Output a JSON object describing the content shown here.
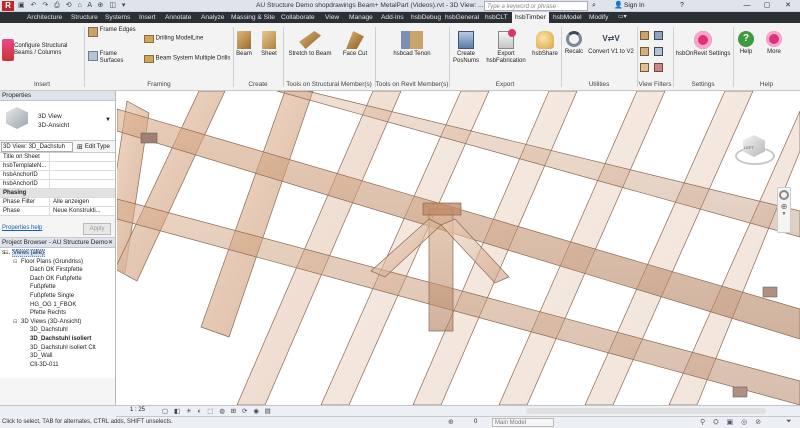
{
  "window": {
    "title": "AU Structure Demo shopdrawings Beam+ MetalPart (Videos).rvt - 3D View: ...",
    "search_placeholder": "Type a keyword or phrase",
    "sign_in": "Sign In"
  },
  "menu": {
    "tabs": [
      "Architecture",
      "Structure",
      "Systems",
      "Insert",
      "Annotate",
      "Analyze",
      "Massing & Site",
      "Collaborate",
      "View",
      "Manage",
      "Add-Ins",
      "hsbDebug",
      "hsbGeneral",
      "hsbCLT",
      "hsbTimber",
      "hsbModel",
      "Modify"
    ],
    "active": "hsbTimber"
  },
  "ribbon": {
    "insert": {
      "configure": "Configure Structural Beams / Columns",
      "group": "Insert"
    },
    "framing": {
      "frame_edges": "Frame Edges",
      "frame_surfaces": "Frame Surfaces",
      "drilling": "Drilling ModelLine",
      "beam_system": "Beam System Multiple Drills",
      "group": "Framing"
    },
    "create": {
      "beam": "Beam",
      "sheet": "Sheet",
      "group": "Create"
    },
    "tools_structural": {
      "stretch": "Stretch to Beam",
      "facecut": "Face Cut",
      "group": "Tools on Structural Member(s)"
    },
    "tools_revit": {
      "tenon": "hsbcad Tenon",
      "group": "Tools on Revit Member(s)"
    },
    "export": {
      "create_posnums": "Create PosNums",
      "export_fab": "Export hsbFabrication",
      "share": "hsbShare",
      "group": "Export"
    },
    "utilities": {
      "recalc": "Recalc",
      "convert": "Convert V1 to V2",
      "group": "Utilities"
    },
    "view_filters": {
      "group": "View Filters"
    },
    "settings": {
      "onrevit": "hsbOnRevit Settings",
      "group": "Settings"
    },
    "help": {
      "help": "Help",
      "more": "More",
      "group": "Help"
    }
  },
  "properties": {
    "header": "Properties",
    "type_line1": "3D View",
    "type_line2": "3D-Ansicht",
    "selector": "3D View: 3D_Dachstuh",
    "edit_type": "Edit Type",
    "rows": [
      [
        "Title on Sheet",
        ""
      ],
      [
        "hsbTemplateN...",
        ""
      ],
      [
        "hsbAnchorID",
        ""
      ],
      [
        "hsbAnchorID",
        ""
      ]
    ],
    "section": "Phasing",
    "phase_rows": [
      [
        "Phase Filter",
        "Alle anzeigen"
      ],
      [
        "Phase",
        "Neue Konstrukti..."
      ]
    ],
    "help_link": "Properties help",
    "apply": "Apply"
  },
  "browser": {
    "header": "Project Browser - AU Structure Demo s...",
    "items": [
      {
        "label": "Views (alle)",
        "indent": 0,
        "bold": false,
        "sel": true
      },
      {
        "label": "Floor Plans (Grundriss)",
        "indent": 1,
        "bold": false,
        "sel": false
      },
      {
        "label": "Dach OK Firstpfette",
        "indent": 2,
        "bold": false,
        "sel": false
      },
      {
        "label": "Dach OK Fußpfette",
        "indent": 2,
        "bold": false,
        "sel": false
      },
      {
        "label": "Fußpfette",
        "indent": 2,
        "bold": false,
        "sel": false
      },
      {
        "label": "Fußpfette Single",
        "indent": 2,
        "bold": false,
        "sel": false
      },
      {
        "label": "HG_OG 1_FBOK",
        "indent": 2,
        "bold": false,
        "sel": false
      },
      {
        "label": "Pfette Rechts",
        "indent": 2,
        "bold": false,
        "sel": false
      },
      {
        "label": "3D Views (3D-Ansicht)",
        "indent": 1,
        "bold": false,
        "sel": false
      },
      {
        "label": "3D_Dachstuhl",
        "indent": 2,
        "bold": false,
        "sel": false
      },
      {
        "label": "3D_Dachstuhl isoliert",
        "indent": 2,
        "bold": true,
        "sel": false
      },
      {
        "label": "3D_Dachstuhl isoliert Clt",
        "indent": 2,
        "bold": false,
        "sel": false
      },
      {
        "label": "3D_Wall",
        "indent": 2,
        "bold": false,
        "sel": false
      },
      {
        "label": "Clt-3D-011",
        "indent": 2,
        "bold": false,
        "sel": false
      }
    ]
  },
  "status": {
    "scale": "1 : 25",
    "hint": "Click to select, TAB for alternates, CTRL adds, SHIFT unselects.",
    "zero": "0",
    "model": "Main Model"
  },
  "viewcube": {
    "face": "LEFT"
  }
}
